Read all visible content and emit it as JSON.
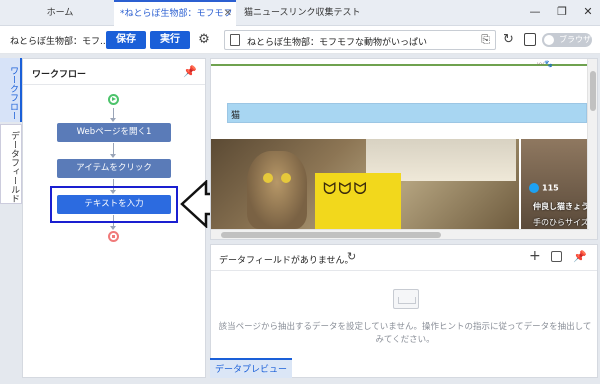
{
  "tabs": {
    "home": "ホーム",
    "active": "*ねとらぼ生物部：モフモフ",
    "third": "猫ニュースリンク収集テスト"
  },
  "window_controls": {
    "minimize": "—",
    "restore": "❐",
    "close": "✕"
  },
  "toolbar": {
    "task_name": "ねとらぼ生物部：モフ...",
    "save_label": "保存",
    "run_label": "実行",
    "url": "ねとらぼ生物部：モフモフな動物がいっぱい",
    "browser_toggle_label": "ブラウザ"
  },
  "side_tabs": {
    "workflow": "ワークフロー",
    "datafield": "データフィールド"
  },
  "workflow": {
    "title": "ワークフロー",
    "nodes": [
      {
        "label": "Webページを開く1"
      },
      {
        "label": "アイテムをクリック"
      },
      {
        "label": "テキストを入力"
      }
    ]
  },
  "web": {
    "cat_label": "猫",
    "side_count": "115",
    "side_title": "仲良し猫きょう",
    "side_caption": "手のひらサイズ"
  },
  "data_panel": {
    "empty_title": "データフィールドがありません。",
    "empty_hint": "該当ページから抽出するデータを設定していません。操作ヒントの指示に従ってデータを抽出してみてください。"
  },
  "bottom_tab": "データプレビュー",
  "colors": {
    "accent": "#1a5fd8",
    "node": "#5a7bb8",
    "highlight": "#1a1fd0"
  },
  "icons": {
    "settings": "gear-icon",
    "refresh": "refresh-icon",
    "pin": "pin-icon",
    "add": "plus-icon",
    "start": "play-circle-icon",
    "end": "stop-circle-icon"
  }
}
